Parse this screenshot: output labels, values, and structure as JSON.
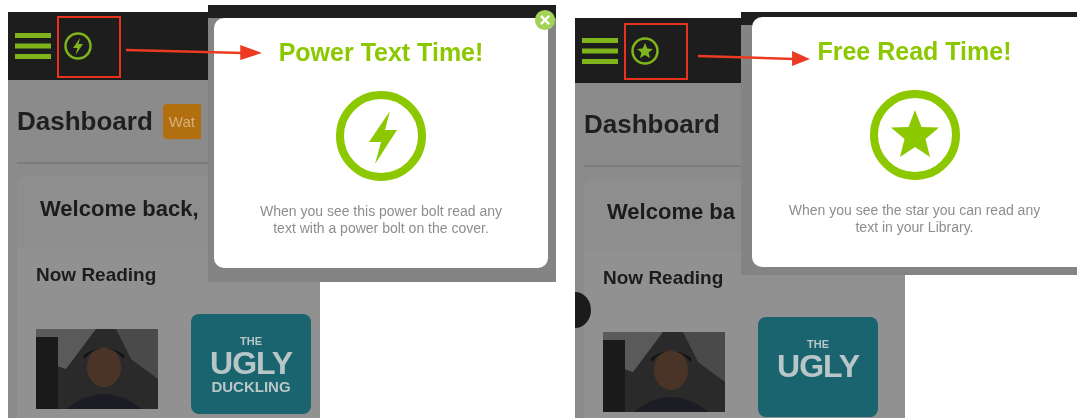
{
  "panels": [
    {
      "kind": "power",
      "app": {
        "title": "Dashboard",
        "button": "Wat",
        "welcome": "Welcome back,",
        "section": "Now Reading",
        "carousel_arrow": false,
        "books": [
          {
            "kind": "picture"
          },
          {
            "kind": "cover",
            "lines": [
              "THE",
              "UGLY",
              "DUCKLING"
            ]
          }
        ]
      },
      "popup": {
        "title": "Power Text Time!",
        "text": "When you see this power bolt read any text with a power bolt on the cover.",
        "close_button": true
      }
    },
    {
      "kind": "star",
      "app": {
        "title": "Dashboard",
        "welcome": "Welcome ba",
        "section": "Now Reading",
        "carousel_arrow": true,
        "books": [
          {
            "kind": "picture"
          },
          {
            "kind": "cover",
            "lines": [
              "THE",
              "UGLY"
            ]
          }
        ]
      },
      "popup": {
        "title": "Free Read Time!",
        "text": "When you see the star you can read any text in your Library.",
        "close_button": false
      }
    }
  ]
}
